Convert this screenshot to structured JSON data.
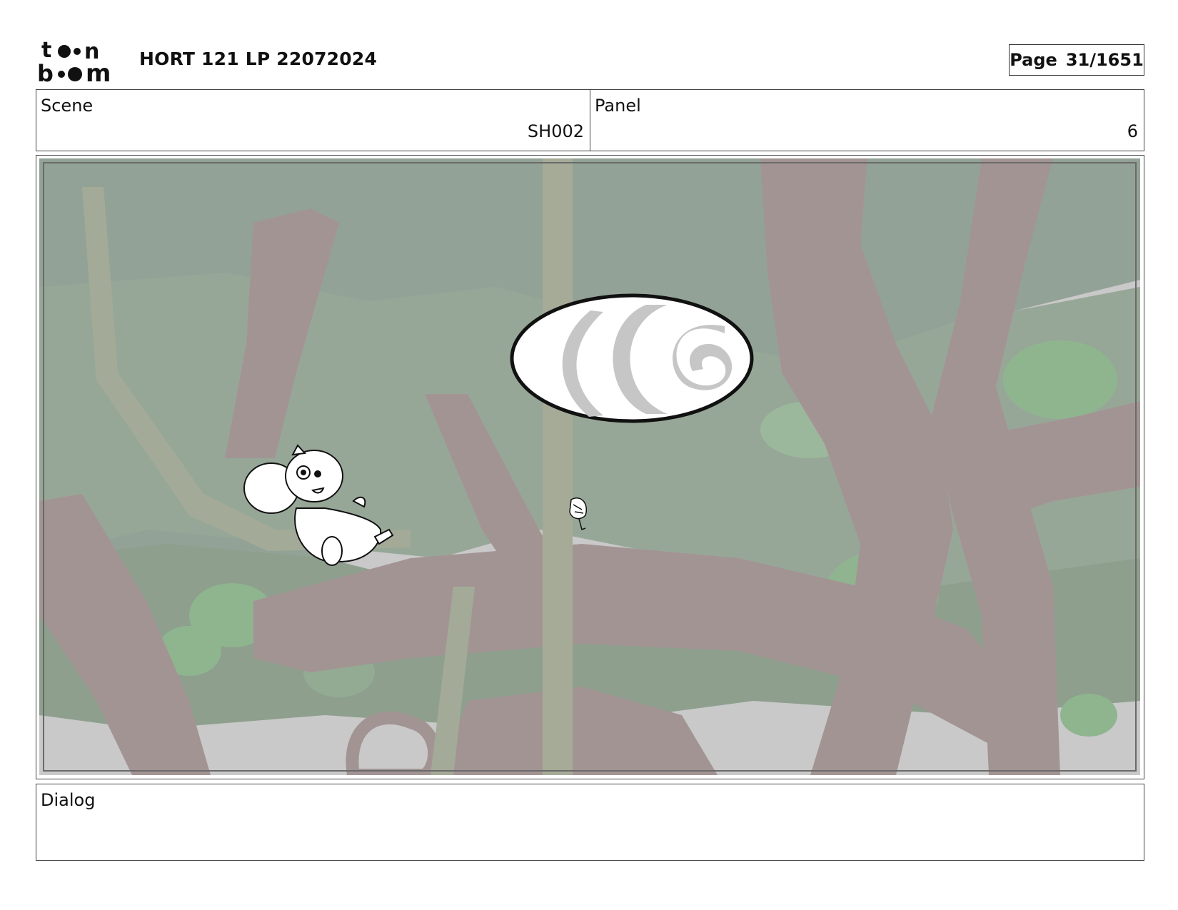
{
  "header": {
    "logo_text": [
      "to",
      "n",
      "b",
      "m"
    ],
    "project_title": "HORT 121 LP 22072024",
    "page_label": "Page",
    "page_number": "31/1651"
  },
  "info": {
    "scene_label": "Scene",
    "scene_value": "SH002",
    "panel_label": "Panel",
    "panel_value": "6"
  },
  "panel": {
    "image_name": "storyboard-drawing",
    "sky_color": "#c9c9c9",
    "foliage_color": "#93a296",
    "trunk_color": "#a39494",
    "bright_leaf_color": "#8fb58f"
  },
  "dialog": {
    "label": "Dialog",
    "text": ""
  }
}
